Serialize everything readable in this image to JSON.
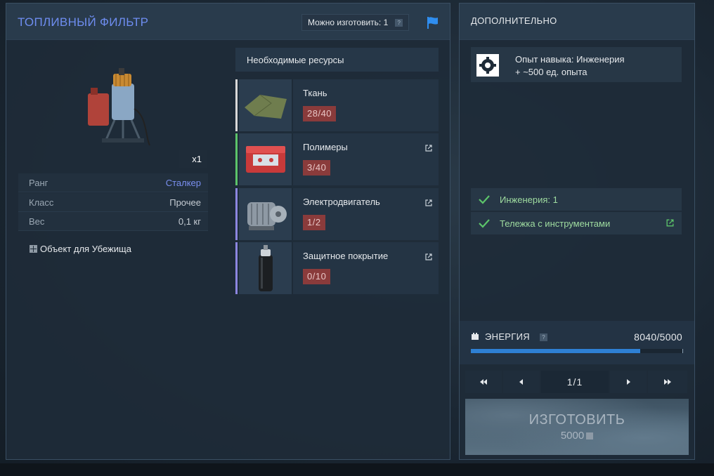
{
  "item": {
    "title": "ТОПЛИВНЫЙ ФИЛЬТР",
    "craftable_label": "Можно изготовить: 1",
    "quantity": "x1",
    "stats": [
      {
        "label": "Ранг",
        "value": "Сталкер"
      },
      {
        "label": "Класс",
        "value": "Прочее"
      },
      {
        "label": "Вес",
        "value": "0,1 кг"
      }
    ],
    "shelter_tag": "Объект для Убежища"
  },
  "resources": {
    "header": "Необходимые ресурсы",
    "items": [
      {
        "name": "Ткань",
        "count": "28/40",
        "bar_color": "#d8d8d8",
        "icon": "fabric-icon"
      },
      {
        "name": "Полимеры",
        "count": "3/40",
        "bar_color": "#5cc46a",
        "icon": "polymer-box-icon"
      },
      {
        "name": "Электродвигатель",
        "count": "1/2",
        "bar_color": "#8c86e0",
        "icon": "electric-motor-icon"
      },
      {
        "name": "Защитное покрытие",
        "count": "0/10",
        "bar_color": "#8c86e0",
        "icon": "spray-can-icon"
      }
    ]
  },
  "extra": {
    "title": "ДОПОЛНИТЕЛЬНО",
    "skill_line1": "Опыт навыка: Инженерия",
    "skill_line2": "+ ~500 ед. опыта",
    "requirements": [
      {
        "text": "Инженерия: 1"
      },
      {
        "text": "Тележка с инструментами"
      }
    ]
  },
  "energy": {
    "label": "ЭНЕРГИЯ",
    "value": "8040/5000",
    "fill_fraction": 0.8
  },
  "pager": {
    "page": "1/1"
  },
  "craft": {
    "label": "ИЗГОТОВИТЬ",
    "cost": "5000"
  },
  "colors": {
    "title_accent": "#6e8df0",
    "energy_fill": "#2e80d4",
    "deficit_badge": "#8a3b3b",
    "check": "#5cc46a"
  }
}
